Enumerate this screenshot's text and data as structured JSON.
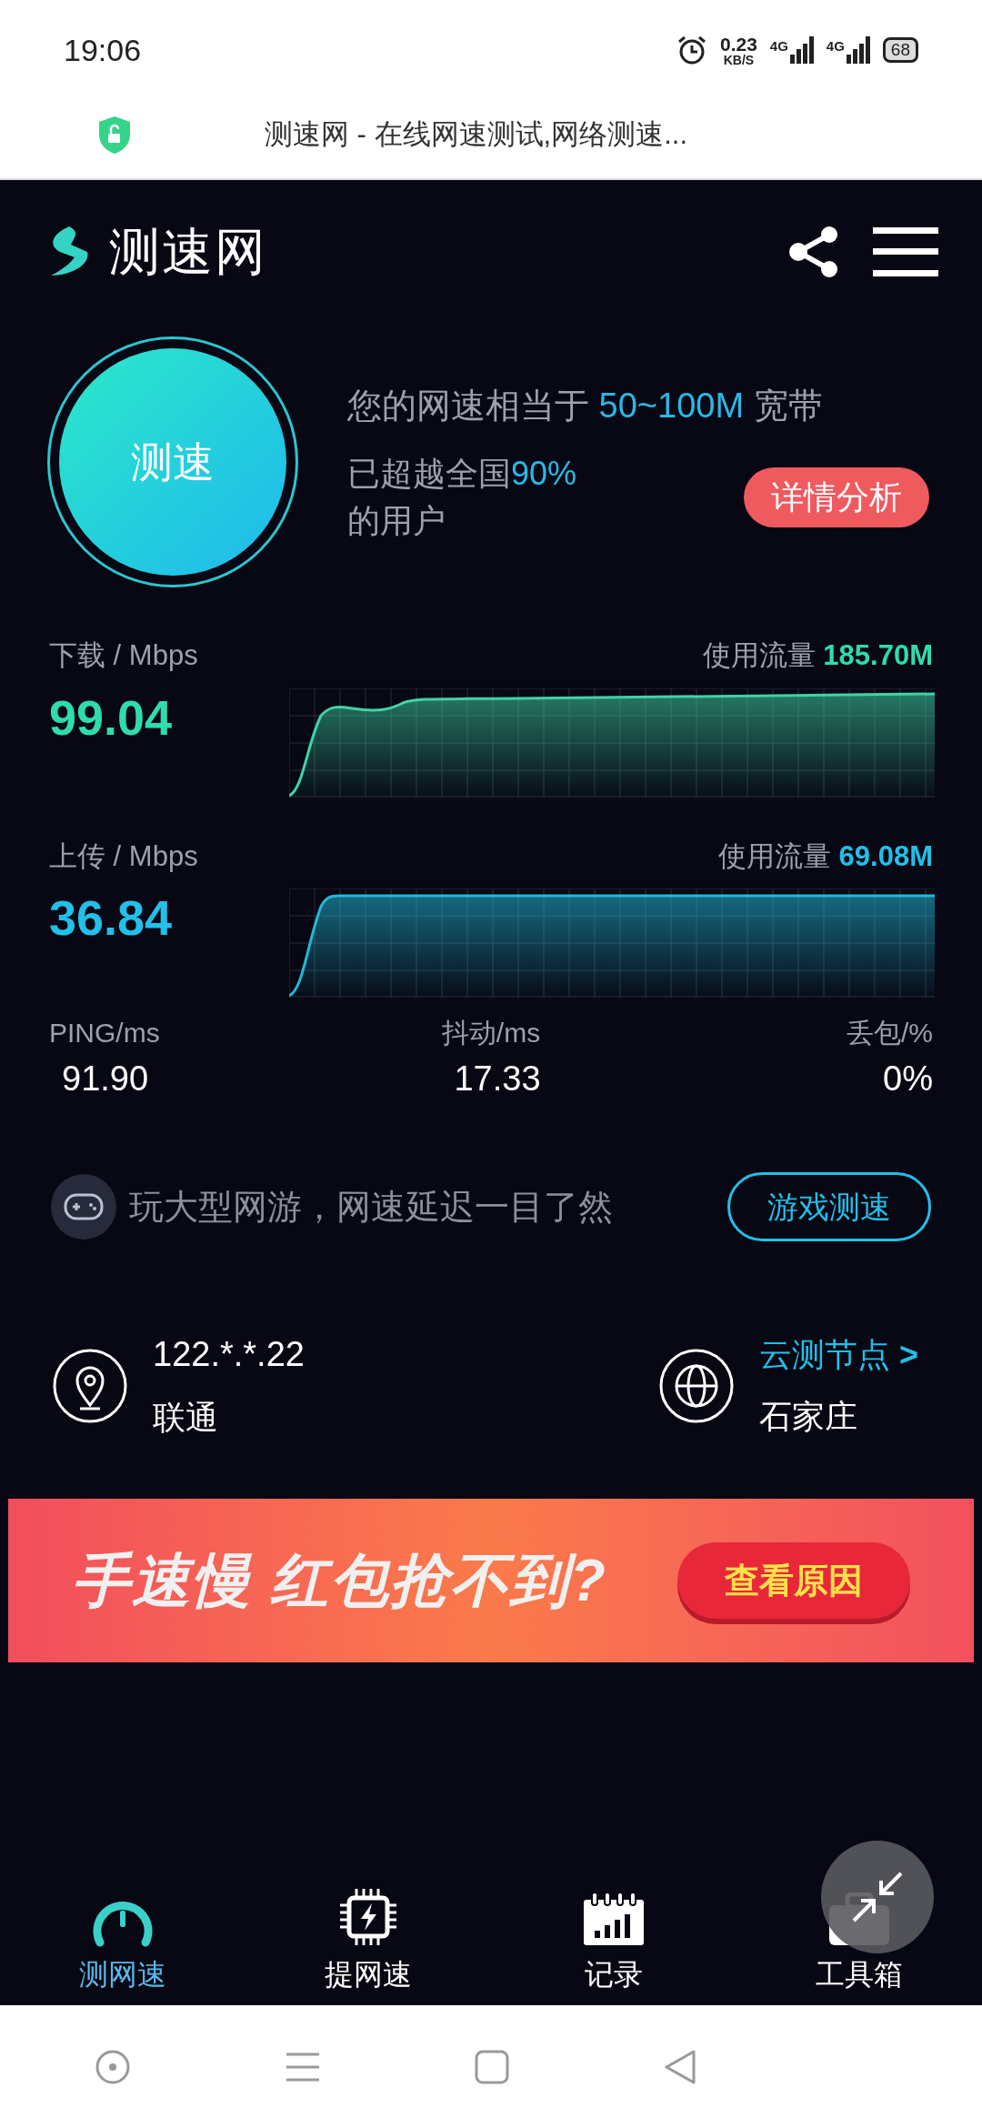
{
  "status_bar": {
    "time": "19:06",
    "net_speed": "0.23",
    "net_unit": "KB/S",
    "sim1": "4G",
    "sim2": "4G",
    "battery": "68"
  },
  "url_bar": {
    "title": "测速网 - 在线网速测试,网络测速..."
  },
  "header": {
    "logo_text": "测速网"
  },
  "speed_test": {
    "button": "测速",
    "equivalent_prefix": "您的网速相当于",
    "equivalent_value": "50~100M",
    "equivalent_suffix": "宽带",
    "beats_prefix": "已超越全国",
    "beats_value": "90%",
    "beats_suffix": "的用户",
    "details_button": "详情分析"
  },
  "metrics": [
    {
      "kind": "download",
      "label": "下载 / Mbps",
      "value": "99.04",
      "usage_label": "使用流量",
      "usage": "185.70M"
    },
    {
      "kind": "upload",
      "label": "上传 / Mbps",
      "value": "36.84",
      "usage_label": "使用流量",
      "usage": "69.08M"
    }
  ],
  "stats": [
    {
      "label": "PING/ms",
      "value": "91.90"
    },
    {
      "label": "抖动/ms",
      "value": "17.33"
    },
    {
      "label": "丢包/%",
      "value": "0%"
    }
  ],
  "game": {
    "text": "玩大型网游，网速延迟一目了然",
    "button": "游戏测速"
  },
  "location": {
    "ip": "122.*.*.22",
    "isp": "联通",
    "node_label": "云测节点",
    "node_arrow": ">",
    "city": "石家庄"
  },
  "banner": {
    "headline": "手速慢 红包抢不到?",
    "button": "查看原因"
  },
  "bottom_nav": [
    {
      "kind": "gauge",
      "label": "测网速",
      "selected": true
    },
    {
      "kind": "chip",
      "label": "提网速",
      "selected": false
    },
    {
      "kind": "calendar",
      "label": "记录",
      "selected": false
    },
    {
      "kind": "toolbox",
      "label": "工具箱",
      "selected": false
    }
  ]
}
